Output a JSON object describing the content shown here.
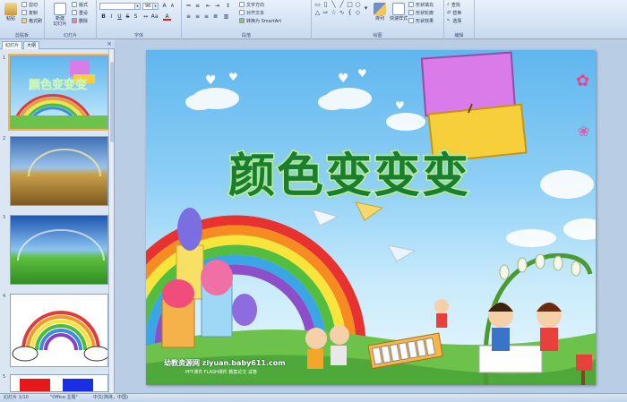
{
  "ribbon": {
    "clipboard": {
      "paste": "粘贴",
      "cut": "剪切",
      "copy": "复制",
      "format_painter": "格式刷",
      "group": "剪贴板"
    },
    "slides": {
      "new_slide": "新建\n幻灯片",
      "layout": "版式",
      "reset": "重设",
      "delete": "删除",
      "group": "幻灯片"
    },
    "font": {
      "font_name": "",
      "font_size": "96",
      "group": "字体"
    },
    "paragraph": {
      "text_direction": "文字方向",
      "align_text": "对齐文本",
      "smartart": "转换为 SmartArt",
      "group": "段落"
    },
    "drawing": {
      "arrange": "排列",
      "quick_styles": "快速样式",
      "shape_fill": "形状填充",
      "shape_outline": "形状轮廓",
      "shape_effects": "形状效果",
      "group": "绘图"
    },
    "editing": {
      "find": "查找",
      "replace": "替换",
      "select": "选择",
      "group": "编辑"
    }
  },
  "pane": {
    "tab_slides": "幻灯片",
    "tab_outline": "大纲"
  },
  "thumbnails": [
    {
      "number": "1"
    },
    {
      "number": "2"
    },
    {
      "number": "3"
    },
    {
      "number": "4"
    },
    {
      "number": "5"
    }
  ],
  "slide": {
    "title": "颜色变变变",
    "watermark_site": "幼教资源网 ziyuan.baby611.com",
    "watermark_sub": "PPT课件 FLASH课件 教案论文 试卷"
  },
  "status": {
    "slide_info": "幻灯片 1/10",
    "theme": "\"Office 主题\"",
    "language": "中文(简体，中国)"
  },
  "colors": {
    "ribbon_bg": "#d5e3f4",
    "pane_bg": "#dbe6f3",
    "editor_bg": "#b9cde5",
    "title_green": "#1b7d2f",
    "selection": "#f2b54a"
  }
}
